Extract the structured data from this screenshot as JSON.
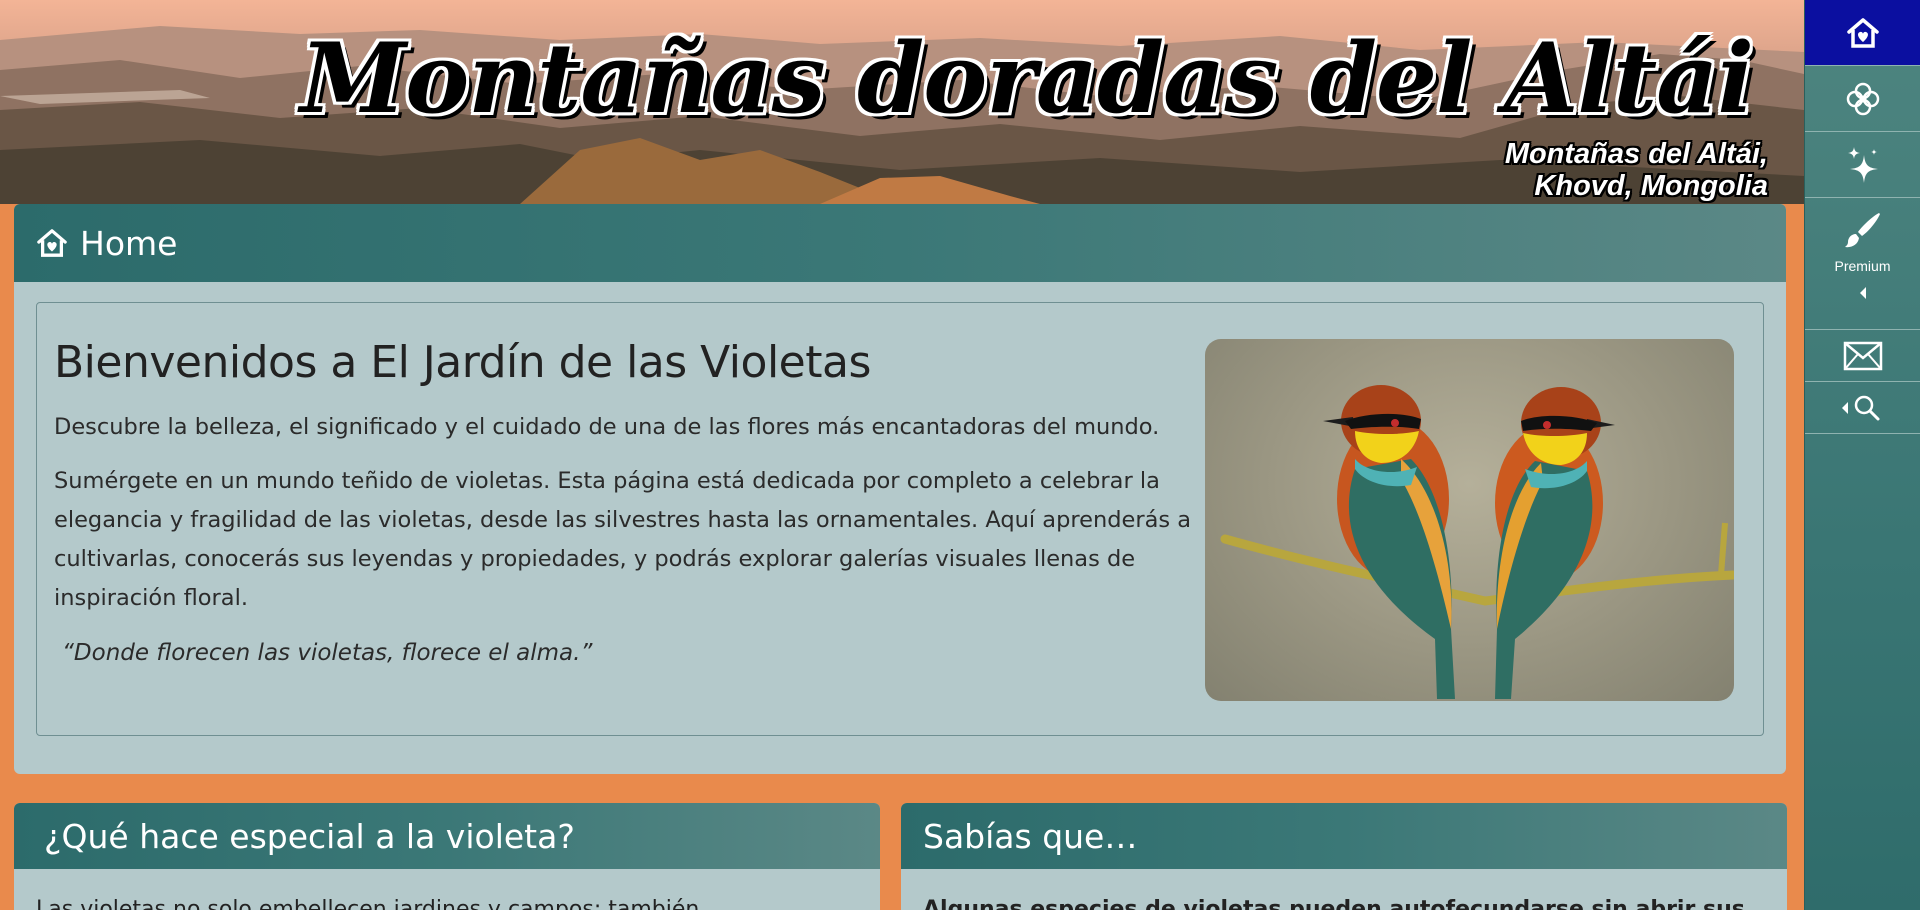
{
  "banner": {
    "title": "Montañas doradas del Altái",
    "location_line1": "Montañas del Altái,",
    "location_line2": "Khovd, Mongolia"
  },
  "sidebar": {
    "items": [
      {
        "icon": "home-icon",
        "active": true
      },
      {
        "icon": "flower-icon"
      },
      {
        "icon": "sparkles-icon"
      },
      {
        "icon": "brush-icon",
        "label": "Premium"
      },
      {
        "icon": "mail-icon"
      },
      {
        "icon": "search-icon"
      }
    ],
    "active_color": "#0b0fa0"
  },
  "home": {
    "header": "Home",
    "title": "Bienvenidos a El Jardín de las Violetas",
    "lead": "Descubre la belleza, el significado y el cuidado de una de las flores más encantadoras del mundo.",
    "body": "Sumérgete en un mundo teñido de violetas. Esta página está dedicada por completo a celebrar la elegancia y fragilidad de las violetas, desde las silvestres hasta las ornamentales. Aquí aprenderás a cultivarlas, conocerás sus leyendas y propiedades, y podrás explorar galerías visuales llenas de inspiración floral.",
    "quote": "“Donde florecen las violetas, florece el alma.”"
  },
  "sections": {
    "left": {
      "title": "¿Qué hace especial a la violeta?",
      "text": "Las violetas no solo embellecen jardines y campos; también"
    },
    "right": {
      "title": "Sabías que…",
      "text": "Algunas especies de violetas pueden autofecundarse sin abrir sus"
    }
  },
  "colors": {
    "page_bg": "#e98a4c",
    "panel_bg": "#b4c9cb",
    "header_teal": "#2c6b6b"
  }
}
